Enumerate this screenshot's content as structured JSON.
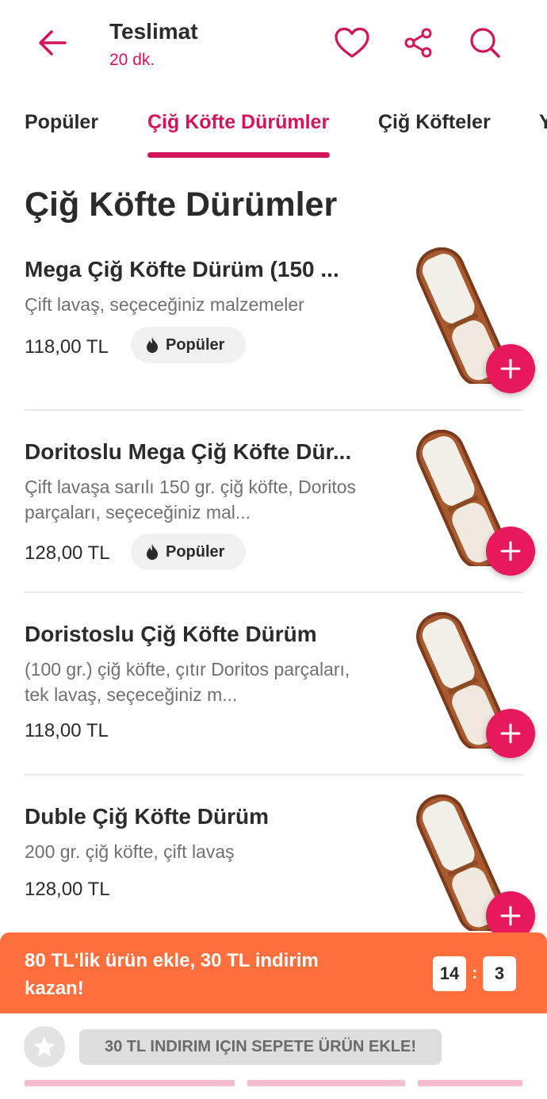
{
  "header": {
    "title": "Teslimat",
    "subtitle": "20 dk.",
    "accent_color": "#d4145a",
    "icons": [
      "back-arrow-icon",
      "heart-icon",
      "share-icon",
      "search-icon"
    ]
  },
  "tabs": [
    {
      "label": "Popüler",
      "active": false
    },
    {
      "label": "Çiğ Köfte Dürümler",
      "active": true
    },
    {
      "label": "Çiğ Köfteler",
      "active": false
    },
    {
      "label": "Y",
      "active": false
    }
  ],
  "section_title": "Çiğ Köfte Dürümler",
  "products": [
    {
      "name": "Mega Çiğ Köfte Dürüm (150 ...",
      "description": "Çift lavaş, seçeceğiniz malzemeler",
      "price": "118,00 TL",
      "badge": "Popüler"
    },
    {
      "name": "Doritoslu Mega Çiğ Köfte Dür...",
      "description": "Çift lavaşa sarılı 150 gr. çiğ köfte, Doritos parçaları, seçeceğiniz mal...",
      "price": "128,00 TL",
      "badge": "Popüler"
    },
    {
      "name": "Doristoslu Çiğ Köfte Dürüm",
      "description": "(100 gr.) çiğ köfte, çıtır Doritos parçaları, tek lavaş, seçeceğiniz m...",
      "price": "118,00 TL",
      "badge": ""
    },
    {
      "name": "Duble Çiğ Köfte Dürüm",
      "description": "200 gr. çiğ köfte, çift lavaş",
      "price": "128,00 TL",
      "badge": ""
    }
  ],
  "promo": {
    "text": "80 TL'lik ürün ekle, 30 TL indirim kazan!",
    "timer_minutes": "14",
    "timer_separator": ":",
    "timer_seconds": "3",
    "color": "#ff6e3d"
  },
  "bottom_bar": {
    "button_label": "30 TL INDIRIM IÇIN SEPETE ÜRÜN EKLE!",
    "icon": "star-icon"
  }
}
